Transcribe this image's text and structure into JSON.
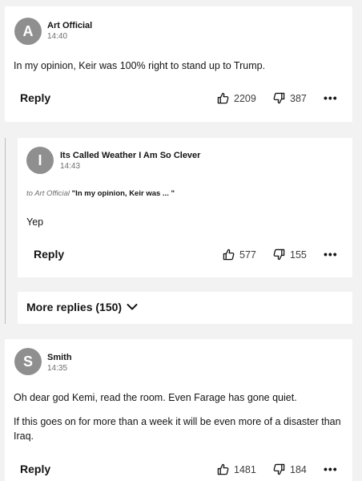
{
  "comments": [
    {
      "avatar_letter": "A",
      "name": "Art Official",
      "time": "14:40",
      "body": [
        "In my opinion, Keir was 100% right to stand up to Trump."
      ],
      "reply_label": "Reply",
      "upvotes": "2209",
      "downvotes": "387",
      "more_label": "•••"
    },
    {
      "avatar_letter": "I",
      "name": "Its Called Weather I Am So Clever",
      "time": "14:43",
      "reply_to_prefix": "to Art Official",
      "reply_to_quote": "\"In my opinion, Keir was ... \"",
      "body": [
        "Yep"
      ],
      "reply_label": "Reply",
      "upvotes": "577",
      "downvotes": "155",
      "more_label": "•••"
    },
    {
      "avatar_letter": "S",
      "name": "Smith",
      "time": "14:35",
      "body": [
        "Oh dear god Kemi, read the room. Even Farage has gone quiet.",
        "If this goes on for more than a week it will be even more of a disaster than",
        "Iraq."
      ],
      "reply_label": "Reply",
      "upvotes": "1481",
      "downvotes": "184",
      "more_label": "•••"
    }
  ],
  "more_replies_label": "More replies (150)",
  "colors": {
    "background": "#f2f2f2",
    "card": "#ffffff",
    "avatar": "#8f8f8f",
    "text": "#141414",
    "muted": "#6e6e6e"
  }
}
